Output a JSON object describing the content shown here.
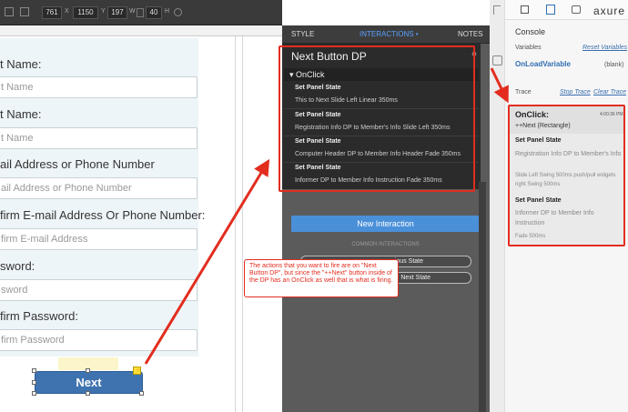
{
  "toolbar": {
    "x": "761",
    "x_label": "X",
    "y": "1150",
    "y_label": "Y",
    "w": "197",
    "w_label": "W",
    "h": "40",
    "h_label": "H"
  },
  "form": {
    "first_name_label": "t Name:",
    "first_name_placeholder": "t Name",
    "last_name_label": "t Name:",
    "last_name_placeholder": "t Name",
    "email_label": "ail Address or Phone Number",
    "email_placeholder": "ail Address or Phone Number",
    "confirm_email_label": "firm E-mail Address Or Phone Number:",
    "confirm_email_placeholder": "firm E-mail Address",
    "password_label": "sword:",
    "password_placeholder": "sword",
    "confirm_password_label": "firm Password:",
    "confirm_password_placeholder": "firm Password",
    "next_button": "Next",
    "lightning": "⚡"
  },
  "inspector": {
    "tabs": {
      "style": "STYLE",
      "interactions": "INTERACTIONS •",
      "notes": "NOTES"
    },
    "dp_title": "Next Button DP",
    "dp_icon": "⚲",
    "event": "▾ OnClick",
    "actions": [
      {
        "title": "Set Panel State",
        "desc": "This to Next Slide Left Linear 350ms"
      },
      {
        "title": "Set Panel State",
        "desc": "Registration Info DP to Member's Info Slide Left 350ms"
      },
      {
        "title": "Set Panel State",
        "desc": "Computer Header DP to Member Info Header Fade 350ms"
      },
      {
        "title": "Set Panel State",
        "desc": "Informer DP to Member Info Instruction Fade 350ms"
      }
    ],
    "new_interaction": "New Interaction",
    "common_title": "COMMON INTERACTIONS",
    "common_btn1": "vious State",
    "common_btn2": "Next State"
  },
  "callout": "The actions that you want to fire are on \"Next Button DP\", but since the \"++Next\" button inside of the DP has an OnClick as well that is what is firing.",
  "console": {
    "logo": "axure",
    "title": "Console",
    "variables_label": "Variables",
    "reset_variables": "Reset Variables",
    "var_name": "OnLoadVariable",
    "var_value": "(blank)",
    "trace_label": "Trace",
    "stop_trace": "Stop Trace",
    "clear_trace": "Clear Trace",
    "trace_event": "OnClick:",
    "trace_time": "4:00:36 PM",
    "trace_source": "++Next (Rectangle)",
    "trace_actions": [
      {
        "title": "Set Panel State",
        "desc": "Registration Info DP to Member's Info",
        "detail": "Slide Left Swing 500ms push/pull widgets right Swing 500ms"
      },
      {
        "title": "Set Panel State",
        "desc": "Informer DP to Member Info Instruction",
        "detail": "Fade 500ms"
      }
    ]
  },
  "colors": {
    "annotation": "#e22d1f",
    "accent": "#4a90d9"
  }
}
